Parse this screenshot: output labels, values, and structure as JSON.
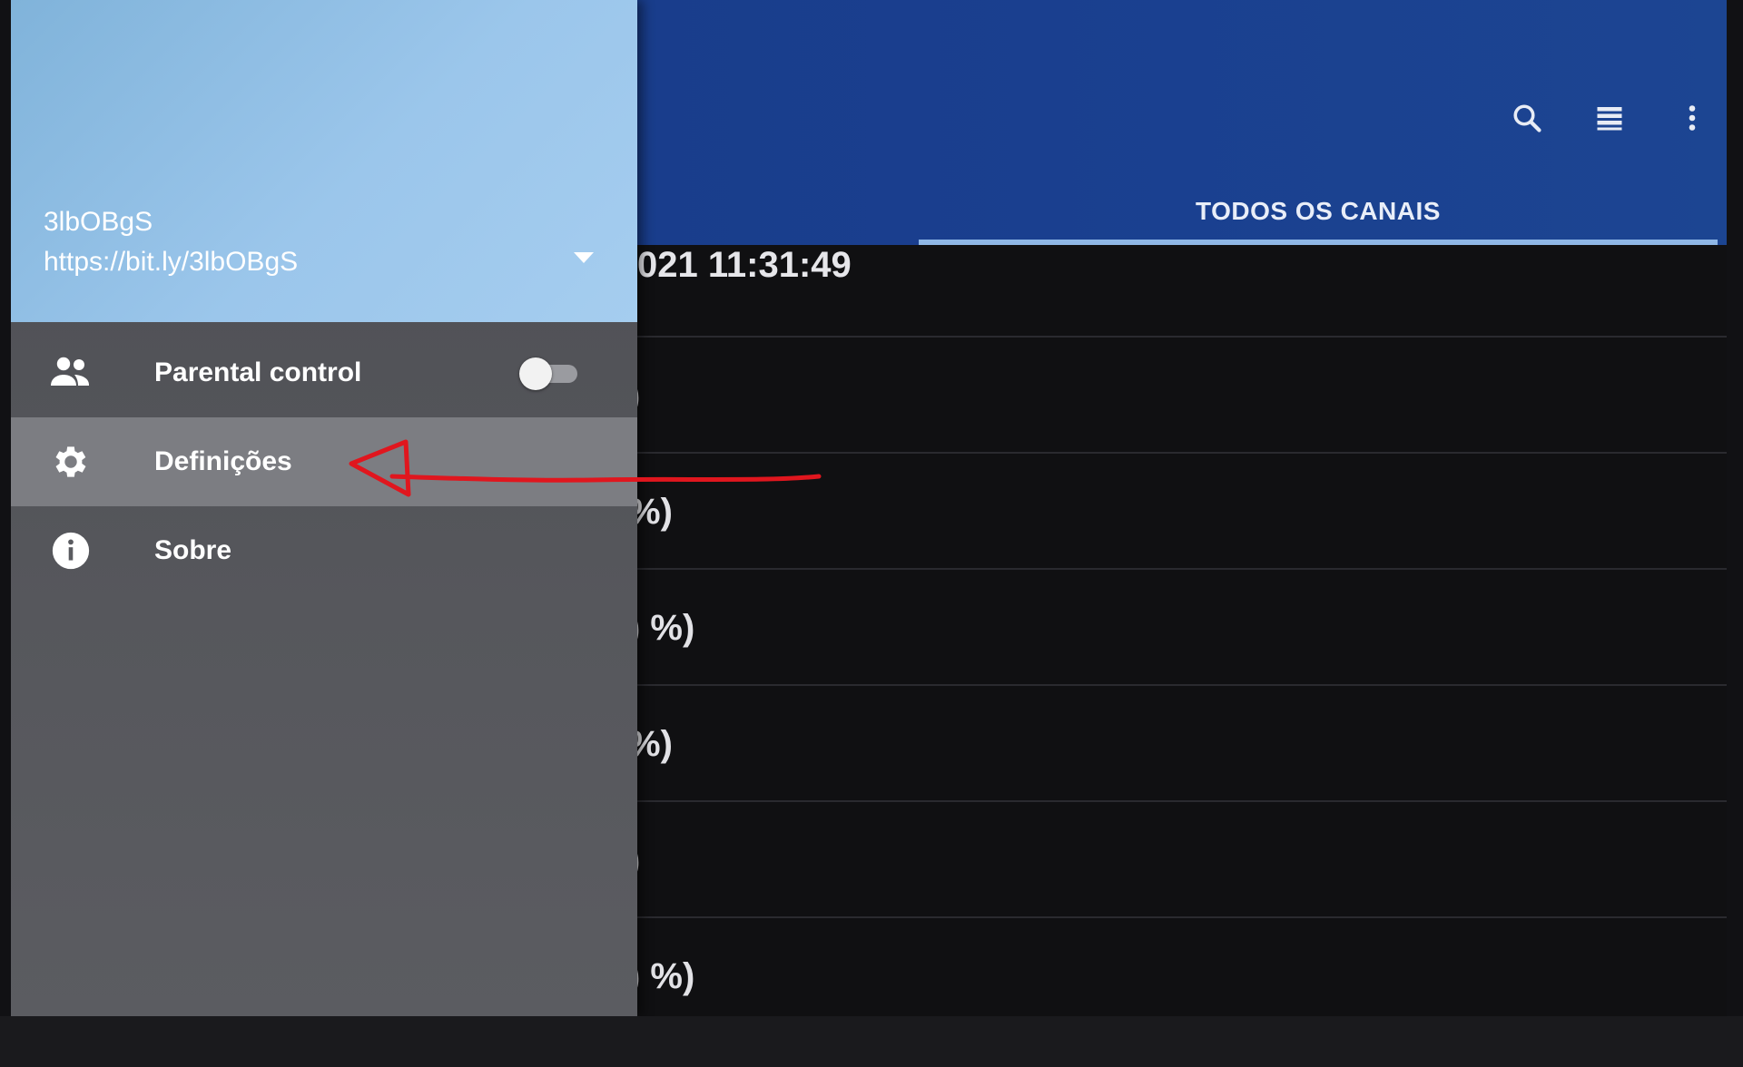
{
  "toolbar": {
    "icons": [
      "search-icon",
      "list-view-icon",
      "more-vert-icon"
    ]
  },
  "tabs": [
    {
      "label": "TODOS OS CANAIS",
      "selected": true
    }
  ],
  "content": {
    "timestamp_text": "021 11:31:49",
    "rows": [
      ")",
      "%)",
      ") %)",
      "%)",
      ")",
      ") %)"
    ]
  },
  "drawer": {
    "account": {
      "name": "3lbOBgS",
      "url": "https://bit.ly/3lbOBgS"
    },
    "items": [
      {
        "label": "Parental control",
        "icon": "people-icon",
        "toggle_on": false
      },
      {
        "label": "Definições",
        "icon": "gear-icon",
        "selected": true
      },
      {
        "label": "Sobre",
        "icon": "info-icon"
      }
    ]
  },
  "colors": {
    "header_blue": "#1a3f8f",
    "drawer_header": "#9bc6eb",
    "tab_indicator": "#8fb7e6",
    "annotation_red": "#e0161e"
  }
}
